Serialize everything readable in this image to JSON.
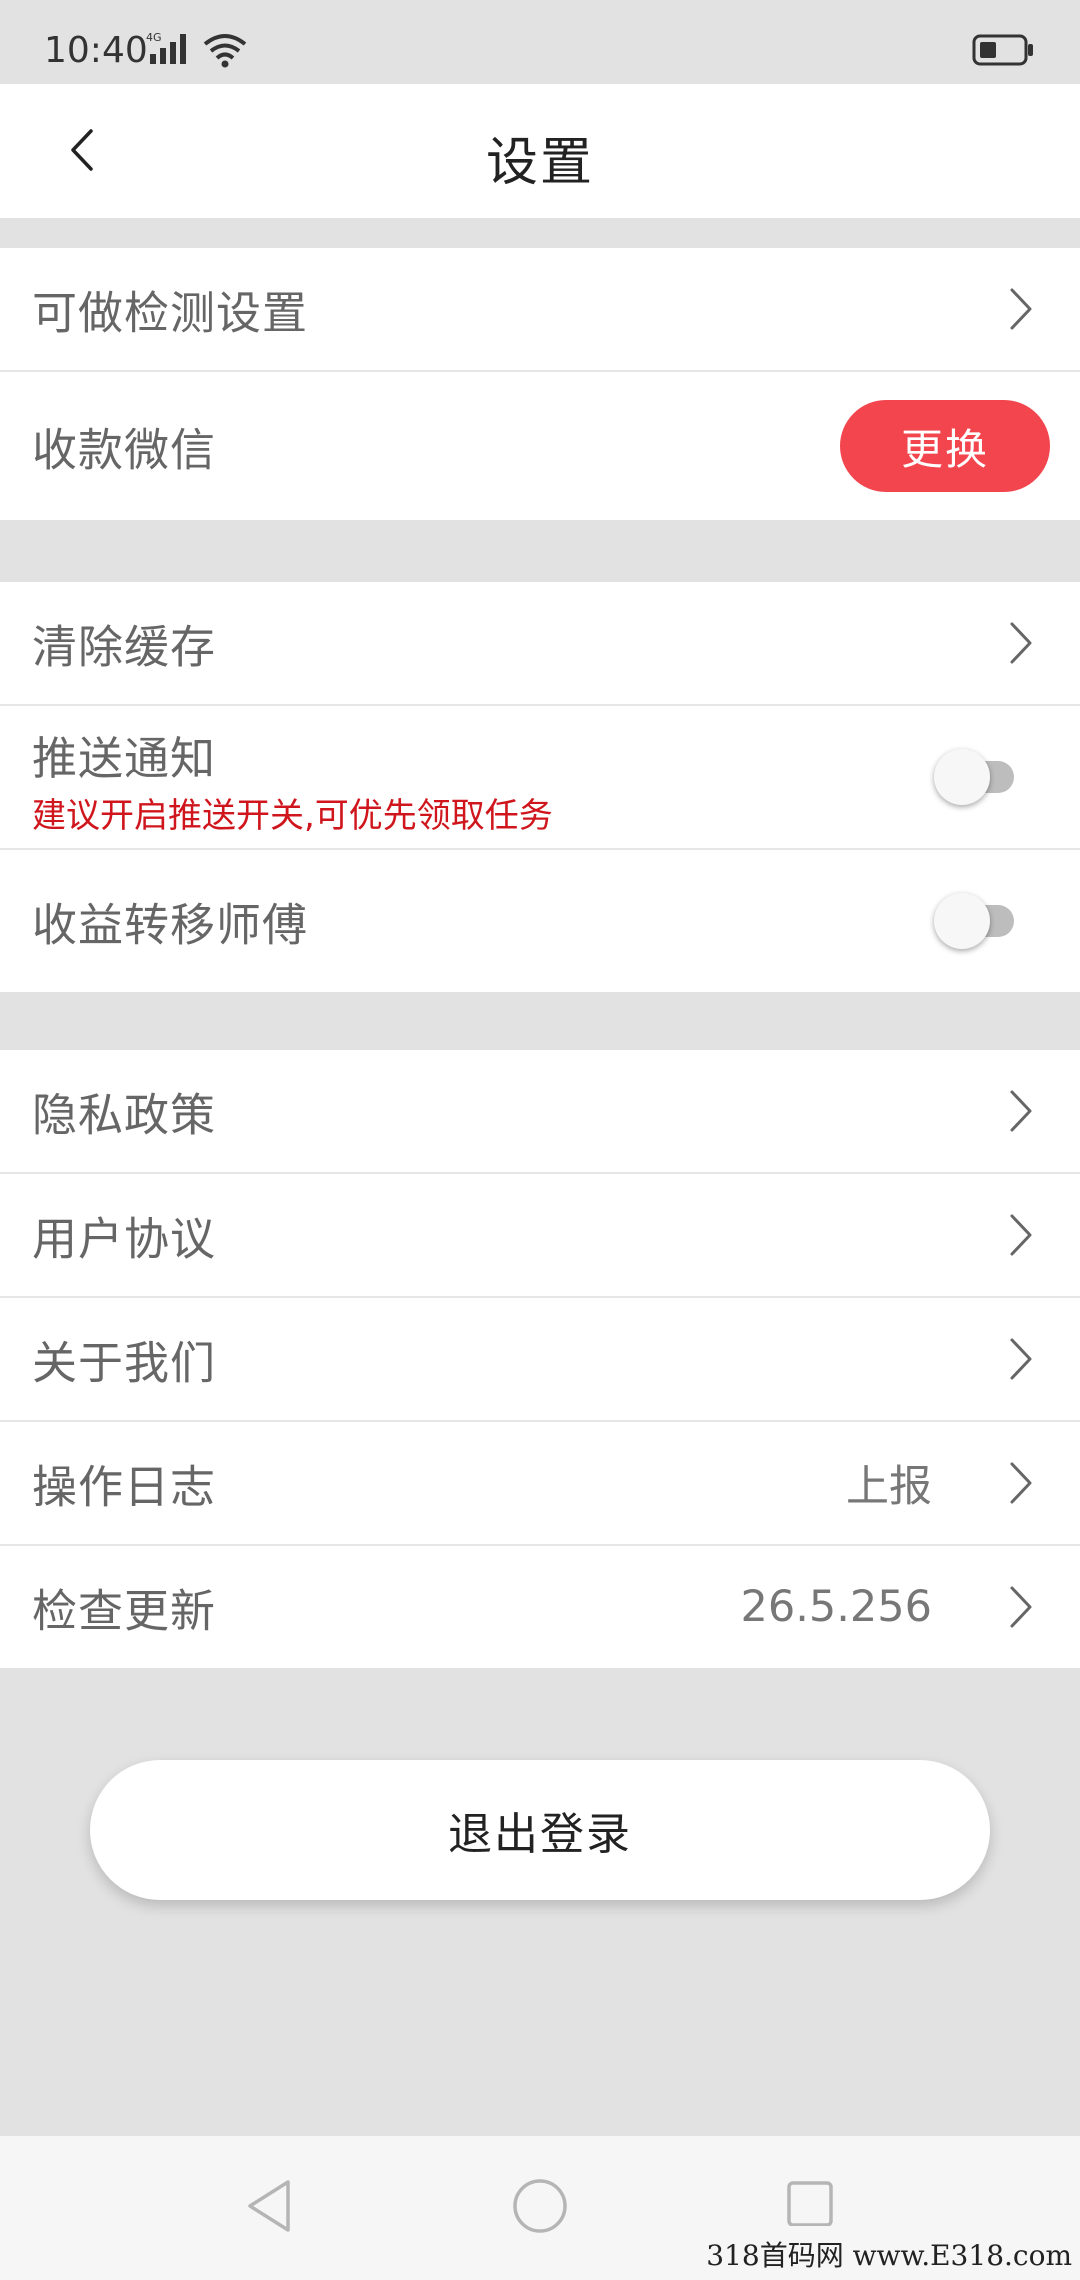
{
  "status_bar": {
    "time": "10:40",
    "network": "4G"
  },
  "header": {
    "title": "设置"
  },
  "group1": {
    "detect_settings": "可做检测设置",
    "wechat_label": "收款微信",
    "wechat_button": "更换"
  },
  "group2": {
    "clear_cache": "清除缓存",
    "push_label": "推送通知",
    "push_hint": "建议开启推送开关,可优先领取任务",
    "transfer_label": "收益转移师傅"
  },
  "group3": {
    "privacy": "隐私政策",
    "agreement": "用户协议",
    "about": "关于我们",
    "log_label": "操作日志",
    "log_value": "上报",
    "update_label": "检查更新",
    "update_value": "26.5.256"
  },
  "logout": "退出登录",
  "watermark": "318首码网 www.E318.com",
  "colors": {
    "accent": "#f3454e",
    "hint_red": "#d0161d",
    "background": "#e2e2e2"
  }
}
